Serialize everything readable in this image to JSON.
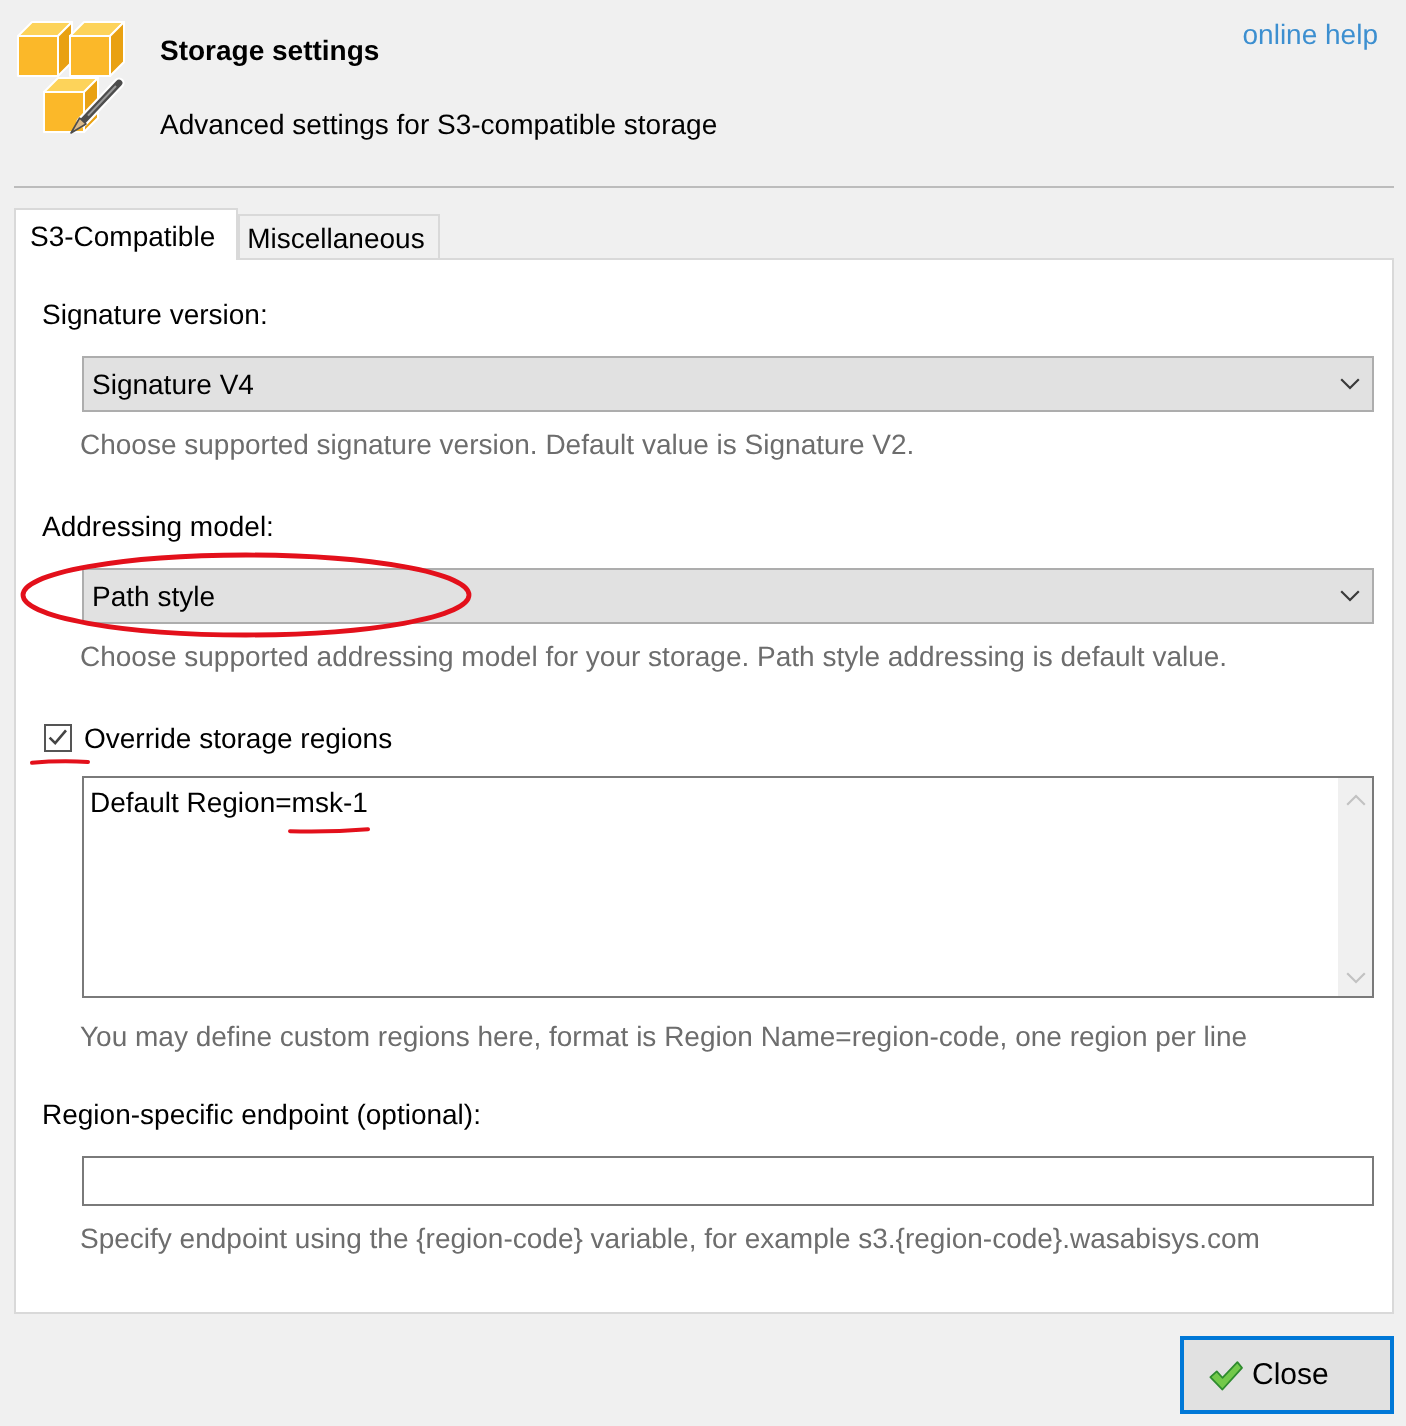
{
  "header": {
    "title": "Storage settings",
    "subtitle": "Advanced settings for S3-compatible storage",
    "help_link": "online help"
  },
  "tabs": [
    {
      "label": "S3-Compatible",
      "selected": true
    },
    {
      "label": "Miscellaneous",
      "selected": false
    }
  ],
  "fields": [
    {
      "kind": "dropdown",
      "label": "Signature version:",
      "value": "Signature V4",
      "hint": "Choose supported signature version. Default value is Signature V2.",
      "circled": false
    },
    {
      "kind": "dropdown",
      "label": "Addressing model:",
      "value": "Path style",
      "hint": "Choose supported addressing model for your storage. Path style addressing is default value.",
      "circled": true
    },
    {
      "kind": "checkbox",
      "label": "Override storage regions",
      "checked": true,
      "underlined": true
    },
    {
      "kind": "textarea",
      "value_parts": [
        {
          "text": "Default Region=",
          "underlined": false
        },
        {
          "text": "msk-1",
          "underlined": true
        }
      ],
      "hint": "You may define custom regions here, format is Region Name=region-code, one region per line"
    },
    {
      "kind": "text_input",
      "label": "Region-specific endpoint (optional):",
      "hint": "Specify endpoint using the {region-code} variable, for example s3.{region-code}.wasabisys.com"
    }
  ],
  "buttons": [
    {
      "label": "Close",
      "focused": true
    }
  ]
}
